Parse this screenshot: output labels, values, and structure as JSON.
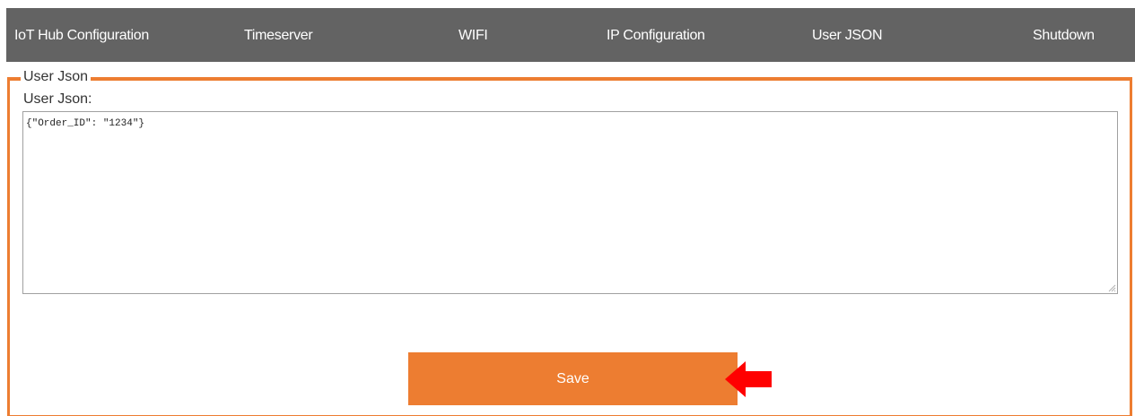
{
  "nav": {
    "items": [
      {
        "label": "IoT Hub Configuration"
      },
      {
        "label": "Timeserver"
      },
      {
        "label": "WIFI"
      },
      {
        "label": "IP Configuration"
      },
      {
        "label": "User JSON"
      },
      {
        "label": "Shutdown"
      }
    ]
  },
  "user_json": {
    "legend": "User Json",
    "field_label": "User Json:",
    "value": "{\"Order_ID\": \"1234\"}",
    "save_label": "Save"
  },
  "colors": {
    "navbar": "#636363",
    "accent": "#ed7d31",
    "arrow": "#ff0000"
  },
  "icons": {
    "annotation": "red-arrow-left-icon",
    "textarea_grip": "resize-grip-icon"
  }
}
